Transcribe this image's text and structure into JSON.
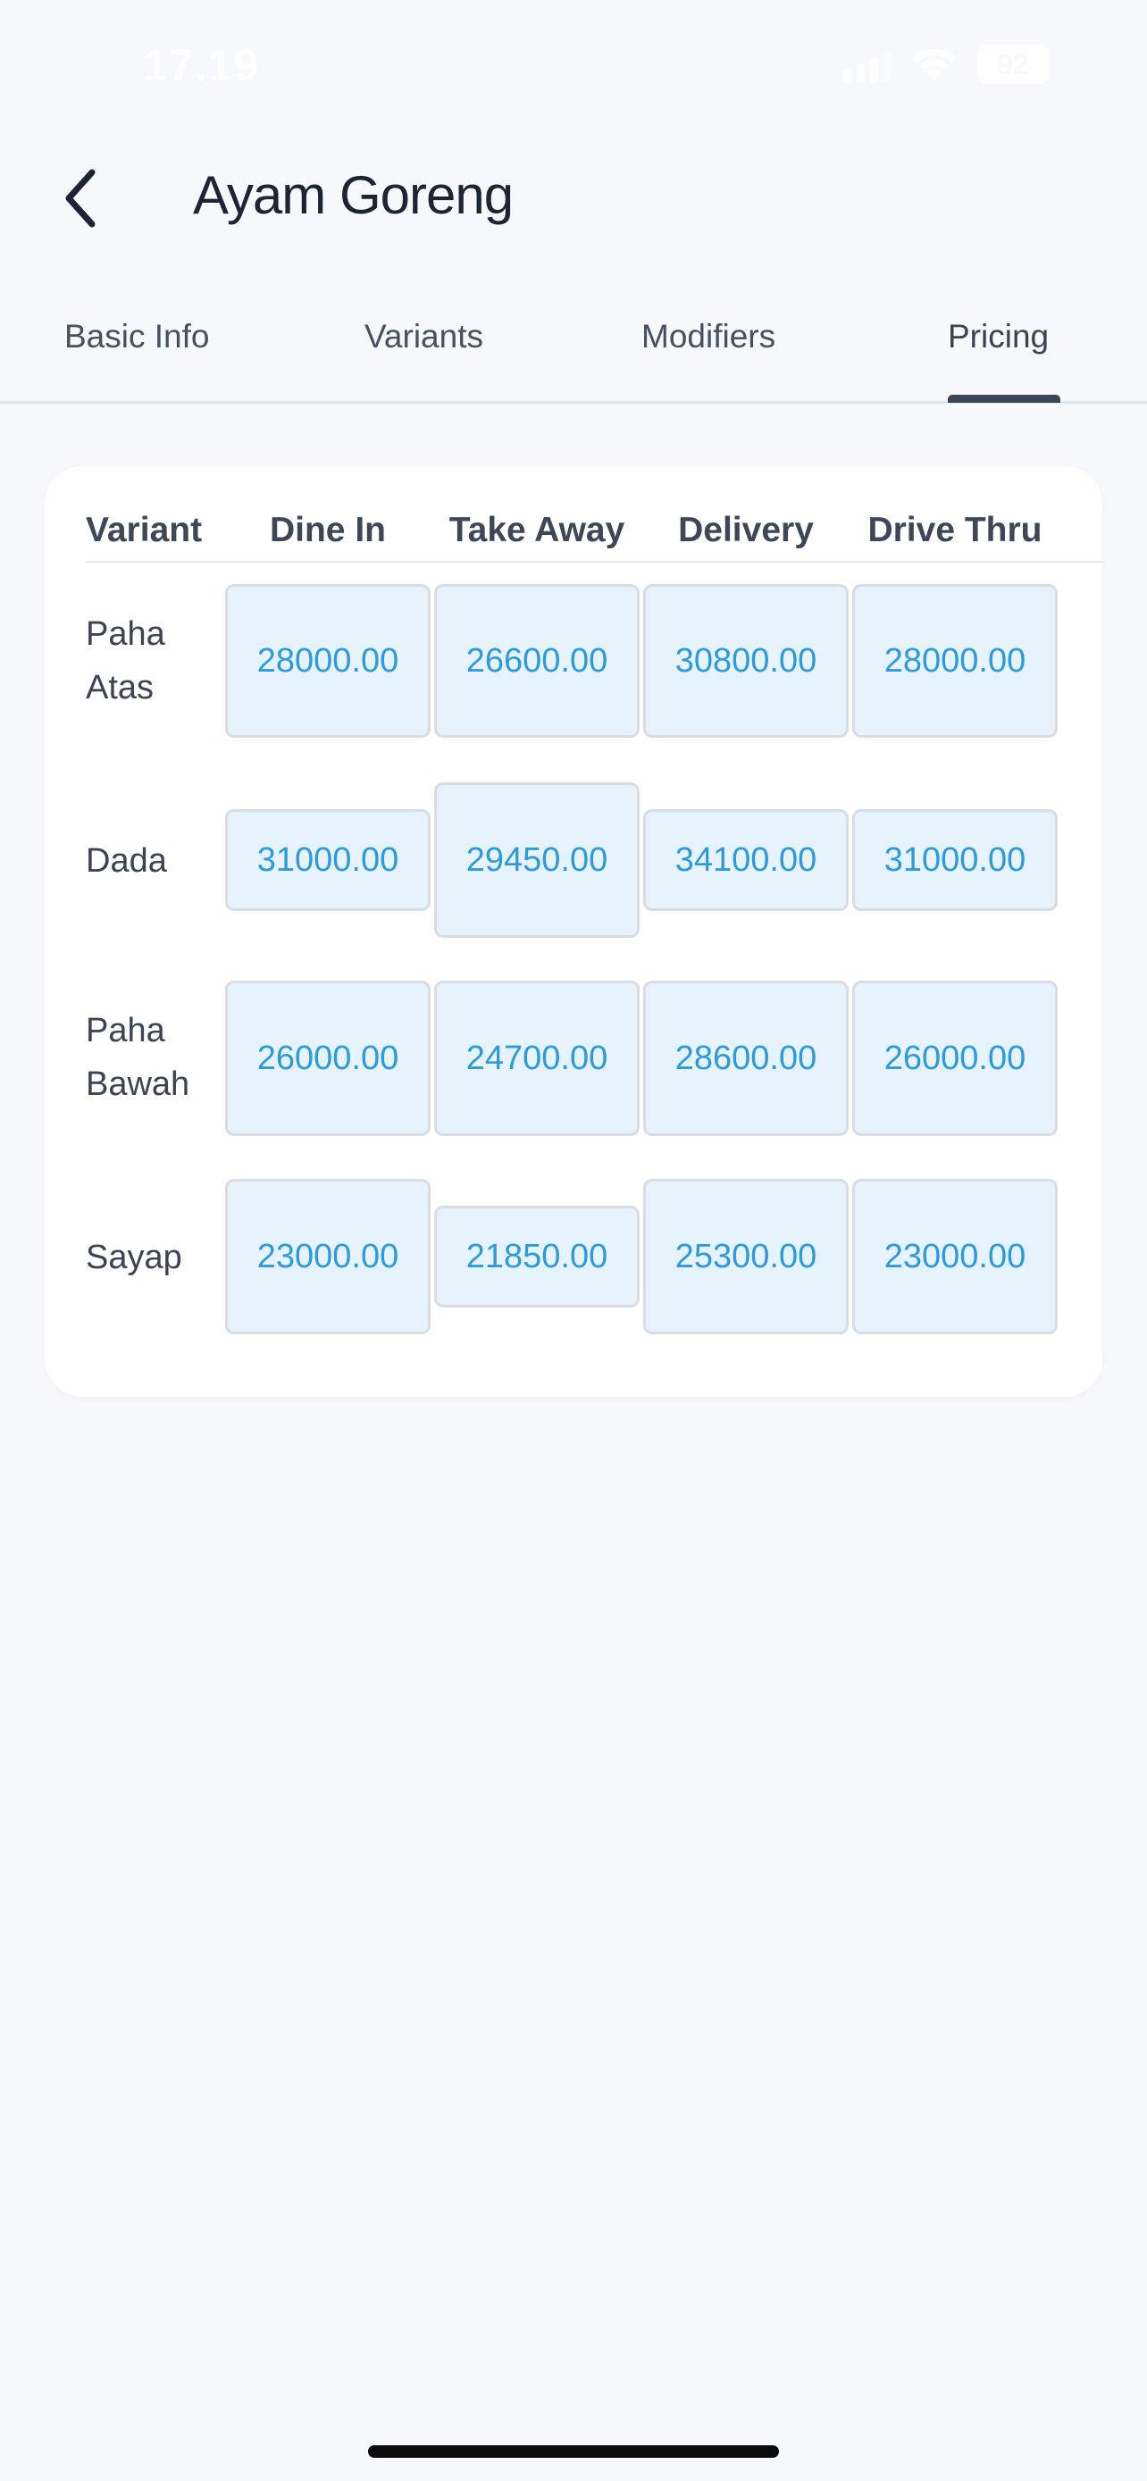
{
  "status_bar": {
    "time": "17.19",
    "battery": "92",
    "icons": [
      "signal-icon",
      "wifi-icon",
      "battery-icon"
    ]
  },
  "header": {
    "title": "Ayam Goreng",
    "back_icon": "chevron-left-icon"
  },
  "tabs": [
    {
      "label": "Basic Info",
      "active": false
    },
    {
      "label": "Variants",
      "active": false
    },
    {
      "label": "Modifiers",
      "active": false
    },
    {
      "label": "Pricing",
      "active": true
    }
  ],
  "pricing": {
    "columns": [
      "Variant",
      "Dine In",
      "Take Away",
      "Delivery",
      "Drive Thru"
    ],
    "rows": [
      {
        "variant": "Paha Atas",
        "prices": [
          "28000.00",
          "26600.00",
          "30800.00",
          "28000.00"
        ]
      },
      {
        "variant": "Dada",
        "prices": [
          "31000.00",
          "29450.00",
          "34100.00",
          "31000.00"
        ]
      },
      {
        "variant": "Paha Bawah",
        "prices": [
          "26000.00",
          "24700.00",
          "28600.00",
          "26000.00"
        ]
      },
      {
        "variant": "Sayap",
        "prices": [
          "23000.00",
          "21850.00",
          "25300.00",
          "23000.00"
        ]
      }
    ]
  },
  "colors": {
    "background": "#f7f8fb",
    "card": "#ffffff",
    "price_text": "#2d9bdb",
    "price_bg": "#e6f3fc",
    "active_tab_indicator": "#3c4556"
  }
}
